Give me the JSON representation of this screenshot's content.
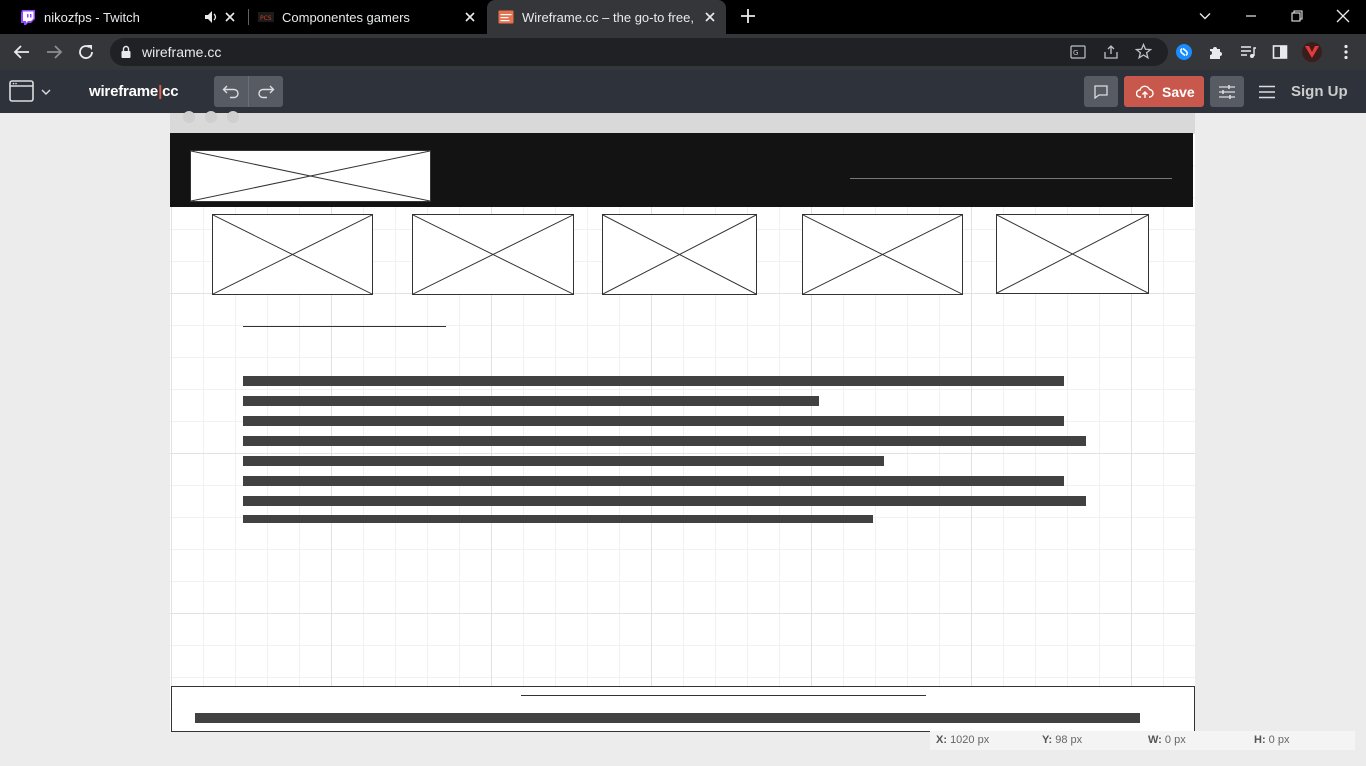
{
  "browser": {
    "tabs": [
      {
        "title": "nikozfps - Twitch",
        "icon": "twitch-icon",
        "audio": true,
        "active": false
      },
      {
        "title": "Componentes gamers",
        "icon": "pcs-icon",
        "active": false
      },
      {
        "title": "Wireframe.cc – the go-to free, on",
        "icon": "wireframe-icon",
        "active": true
      }
    ],
    "url": "wireframe.cc"
  },
  "app": {
    "logo_main": "wireframe",
    "logo_sep": "|",
    "logo_tail": "cc",
    "save_label": "Save",
    "signup_label": "Sign Up"
  },
  "colors": {
    "tab_bar": "#000000",
    "address_bar": "#35363a",
    "app_toolbar": "#2e323a",
    "save_button": "#c7584b",
    "wireframe_header": "#131313",
    "text_bar": "#414141"
  },
  "status": {
    "x_label": "X:",
    "x_value": "1020 px",
    "y_label": "Y:",
    "y_value": "98 px",
    "w_label": "W:",
    "w_value": "0 px",
    "h_label": "H:",
    "h_value": "0 px"
  }
}
